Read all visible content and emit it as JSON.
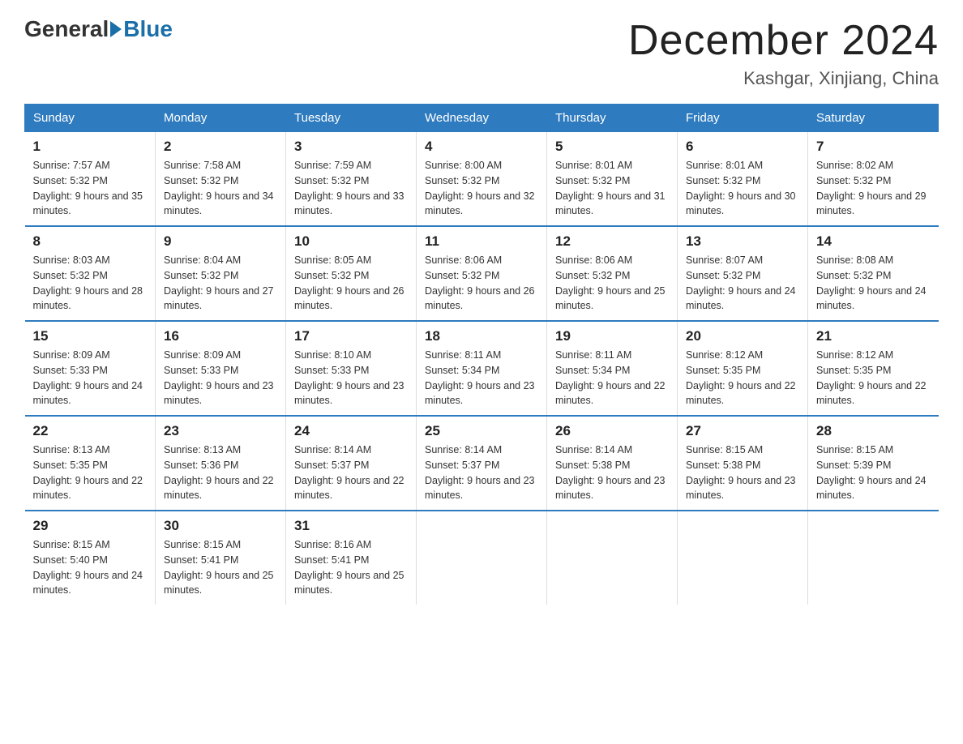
{
  "header": {
    "logo_general": "General",
    "logo_blue": "Blue",
    "month_title": "December 2024",
    "location": "Kashgar, Xinjiang, China"
  },
  "weekdays": [
    "Sunday",
    "Monday",
    "Tuesday",
    "Wednesday",
    "Thursday",
    "Friday",
    "Saturday"
  ],
  "weeks": [
    [
      {
        "day": "1",
        "sunrise": "Sunrise: 7:57 AM",
        "sunset": "Sunset: 5:32 PM",
        "daylight": "Daylight: 9 hours and 35 minutes."
      },
      {
        "day": "2",
        "sunrise": "Sunrise: 7:58 AM",
        "sunset": "Sunset: 5:32 PM",
        "daylight": "Daylight: 9 hours and 34 minutes."
      },
      {
        "day": "3",
        "sunrise": "Sunrise: 7:59 AM",
        "sunset": "Sunset: 5:32 PM",
        "daylight": "Daylight: 9 hours and 33 minutes."
      },
      {
        "day": "4",
        "sunrise": "Sunrise: 8:00 AM",
        "sunset": "Sunset: 5:32 PM",
        "daylight": "Daylight: 9 hours and 32 minutes."
      },
      {
        "day": "5",
        "sunrise": "Sunrise: 8:01 AM",
        "sunset": "Sunset: 5:32 PM",
        "daylight": "Daylight: 9 hours and 31 minutes."
      },
      {
        "day": "6",
        "sunrise": "Sunrise: 8:01 AM",
        "sunset": "Sunset: 5:32 PM",
        "daylight": "Daylight: 9 hours and 30 minutes."
      },
      {
        "day": "7",
        "sunrise": "Sunrise: 8:02 AM",
        "sunset": "Sunset: 5:32 PM",
        "daylight": "Daylight: 9 hours and 29 minutes."
      }
    ],
    [
      {
        "day": "8",
        "sunrise": "Sunrise: 8:03 AM",
        "sunset": "Sunset: 5:32 PM",
        "daylight": "Daylight: 9 hours and 28 minutes."
      },
      {
        "day": "9",
        "sunrise": "Sunrise: 8:04 AM",
        "sunset": "Sunset: 5:32 PM",
        "daylight": "Daylight: 9 hours and 27 minutes."
      },
      {
        "day": "10",
        "sunrise": "Sunrise: 8:05 AM",
        "sunset": "Sunset: 5:32 PM",
        "daylight": "Daylight: 9 hours and 26 minutes."
      },
      {
        "day": "11",
        "sunrise": "Sunrise: 8:06 AM",
        "sunset": "Sunset: 5:32 PM",
        "daylight": "Daylight: 9 hours and 26 minutes."
      },
      {
        "day": "12",
        "sunrise": "Sunrise: 8:06 AM",
        "sunset": "Sunset: 5:32 PM",
        "daylight": "Daylight: 9 hours and 25 minutes."
      },
      {
        "day": "13",
        "sunrise": "Sunrise: 8:07 AM",
        "sunset": "Sunset: 5:32 PM",
        "daylight": "Daylight: 9 hours and 24 minutes."
      },
      {
        "day": "14",
        "sunrise": "Sunrise: 8:08 AM",
        "sunset": "Sunset: 5:32 PM",
        "daylight": "Daylight: 9 hours and 24 minutes."
      }
    ],
    [
      {
        "day": "15",
        "sunrise": "Sunrise: 8:09 AM",
        "sunset": "Sunset: 5:33 PM",
        "daylight": "Daylight: 9 hours and 24 minutes."
      },
      {
        "day": "16",
        "sunrise": "Sunrise: 8:09 AM",
        "sunset": "Sunset: 5:33 PM",
        "daylight": "Daylight: 9 hours and 23 minutes."
      },
      {
        "day": "17",
        "sunrise": "Sunrise: 8:10 AM",
        "sunset": "Sunset: 5:33 PM",
        "daylight": "Daylight: 9 hours and 23 minutes."
      },
      {
        "day": "18",
        "sunrise": "Sunrise: 8:11 AM",
        "sunset": "Sunset: 5:34 PM",
        "daylight": "Daylight: 9 hours and 23 minutes."
      },
      {
        "day": "19",
        "sunrise": "Sunrise: 8:11 AM",
        "sunset": "Sunset: 5:34 PM",
        "daylight": "Daylight: 9 hours and 22 minutes."
      },
      {
        "day": "20",
        "sunrise": "Sunrise: 8:12 AM",
        "sunset": "Sunset: 5:35 PM",
        "daylight": "Daylight: 9 hours and 22 minutes."
      },
      {
        "day": "21",
        "sunrise": "Sunrise: 8:12 AM",
        "sunset": "Sunset: 5:35 PM",
        "daylight": "Daylight: 9 hours and 22 minutes."
      }
    ],
    [
      {
        "day": "22",
        "sunrise": "Sunrise: 8:13 AM",
        "sunset": "Sunset: 5:35 PM",
        "daylight": "Daylight: 9 hours and 22 minutes."
      },
      {
        "day": "23",
        "sunrise": "Sunrise: 8:13 AM",
        "sunset": "Sunset: 5:36 PM",
        "daylight": "Daylight: 9 hours and 22 minutes."
      },
      {
        "day": "24",
        "sunrise": "Sunrise: 8:14 AM",
        "sunset": "Sunset: 5:37 PM",
        "daylight": "Daylight: 9 hours and 22 minutes."
      },
      {
        "day": "25",
        "sunrise": "Sunrise: 8:14 AM",
        "sunset": "Sunset: 5:37 PM",
        "daylight": "Daylight: 9 hours and 23 minutes."
      },
      {
        "day": "26",
        "sunrise": "Sunrise: 8:14 AM",
        "sunset": "Sunset: 5:38 PM",
        "daylight": "Daylight: 9 hours and 23 minutes."
      },
      {
        "day": "27",
        "sunrise": "Sunrise: 8:15 AM",
        "sunset": "Sunset: 5:38 PM",
        "daylight": "Daylight: 9 hours and 23 minutes."
      },
      {
        "day": "28",
        "sunrise": "Sunrise: 8:15 AM",
        "sunset": "Sunset: 5:39 PM",
        "daylight": "Daylight: 9 hours and 24 minutes."
      }
    ],
    [
      {
        "day": "29",
        "sunrise": "Sunrise: 8:15 AM",
        "sunset": "Sunset: 5:40 PM",
        "daylight": "Daylight: 9 hours and 24 minutes."
      },
      {
        "day": "30",
        "sunrise": "Sunrise: 8:15 AM",
        "sunset": "Sunset: 5:41 PM",
        "daylight": "Daylight: 9 hours and 25 minutes."
      },
      {
        "day": "31",
        "sunrise": "Sunrise: 8:16 AM",
        "sunset": "Sunset: 5:41 PM",
        "daylight": "Daylight: 9 hours and 25 minutes."
      },
      {
        "day": "",
        "sunrise": "",
        "sunset": "",
        "daylight": ""
      },
      {
        "day": "",
        "sunrise": "",
        "sunset": "",
        "daylight": ""
      },
      {
        "day": "",
        "sunrise": "",
        "sunset": "",
        "daylight": ""
      },
      {
        "day": "",
        "sunrise": "",
        "sunset": "",
        "daylight": ""
      }
    ]
  ]
}
